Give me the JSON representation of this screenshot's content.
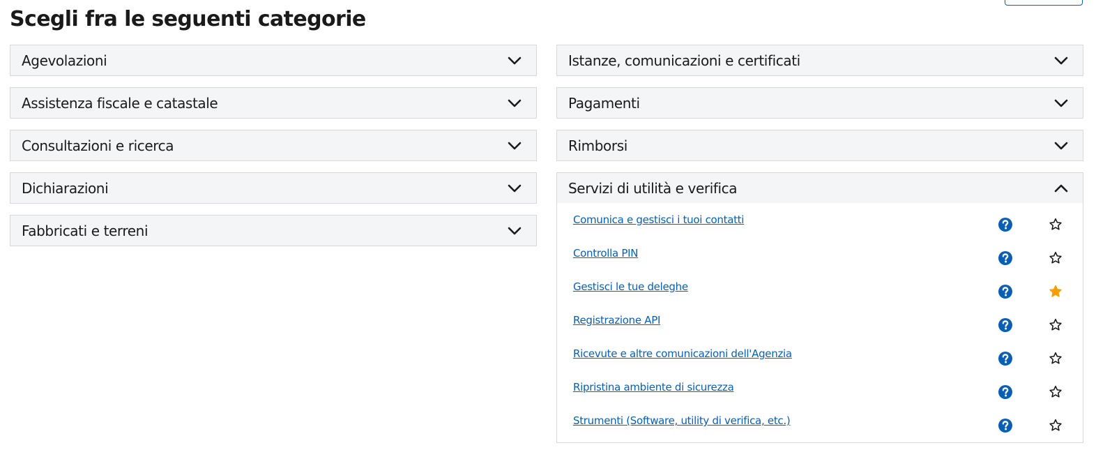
{
  "page": {
    "title": "Scegli fra le seguenti categorie"
  },
  "colors": {
    "link": "#0b5fb3",
    "help_icon": "#0b5fb3",
    "star_active": "#f5a000",
    "header_bg": "#f4f5f6",
    "border": "#d5d8dc"
  },
  "left_categories": [
    {
      "label": "Agevolazioni",
      "icon": "chevron-down-icon"
    },
    {
      "label": "Assistenza fiscale e catastale",
      "icon": "chevron-down-icon"
    },
    {
      "label": "Consultazioni e ricerca",
      "icon": "chevron-down-icon"
    },
    {
      "label": "Dichiarazioni",
      "icon": "chevron-down-icon"
    },
    {
      "label": "Fabbricati e terreni",
      "icon": "chevron-down-icon"
    }
  ],
  "right_categories": [
    {
      "label": "Istanze, comunicazioni e certificati",
      "icon": "chevron-down-icon"
    },
    {
      "label": "Pagamenti",
      "icon": "chevron-down-icon"
    },
    {
      "label": "Rimborsi",
      "icon": "chevron-down-icon"
    },
    {
      "label": "Servizi di utilità e verifica",
      "icon": "chevron-up-icon",
      "expanded": true
    }
  ],
  "services": [
    {
      "label": "Comunica e gestisci i tuoi contatti",
      "favorite": false
    },
    {
      "label": "Controlla PIN",
      "favorite": false
    },
    {
      "label": "Gestisci le tue deleghe",
      "favorite": true
    },
    {
      "label": "Registrazione API",
      "favorite": false
    },
    {
      "label": "Ricevute e altre comunicazioni dell'Agenzia",
      "favorite": false
    },
    {
      "label": "Ripristina ambiente di sicurezza",
      "favorite": false
    },
    {
      "label": "Strumenti (Software, utility di verifica, etc.)",
      "favorite": false
    }
  ]
}
